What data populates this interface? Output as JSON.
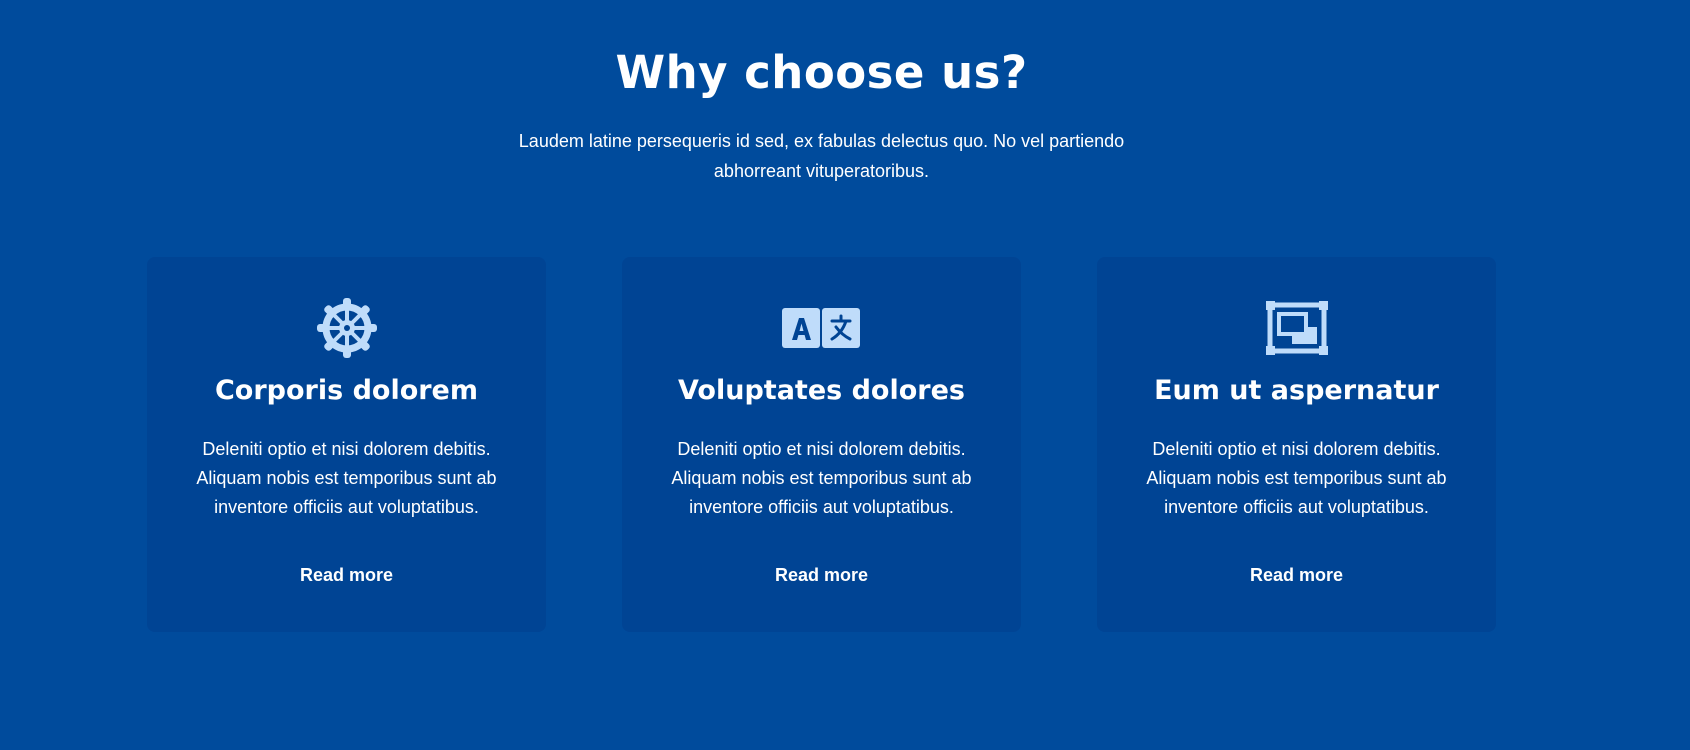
{
  "section": {
    "title": "Why choose us?",
    "subtitle": "Laudem latine persequeris id sed, ex fabulas delectus quo. No vel partiendo abhorreant vituperatoribus."
  },
  "colors": {
    "background": "#004b9c",
    "card_background": "#004494",
    "icon": "#bfdcfa",
    "text": "#ffffff"
  },
  "cards": [
    {
      "icon": "dharma-wheel-icon",
      "title": "Corporis dolorem",
      "text": "Deleniti optio et nisi dolorem debitis. Aliquam nobis est temporibus sunt ab inventore officiis aut voluptatibus.",
      "link_label": "Read more"
    },
    {
      "icon": "translate-icon",
      "title": "Voluptates dolores",
      "text": "Deleniti optio et nisi dolorem debitis. Aliquam nobis est temporibus sunt ab inventore officiis aut voluptatibus.",
      "link_label": "Read more"
    },
    {
      "icon": "picture-in-picture-icon",
      "title": "Eum ut aspernatur",
      "text": "Deleniti optio et nisi dolorem debitis. Aliquam nobis est temporibus sunt ab inventore officiis aut voluptatibus.",
      "link_label": "Read more"
    }
  ]
}
